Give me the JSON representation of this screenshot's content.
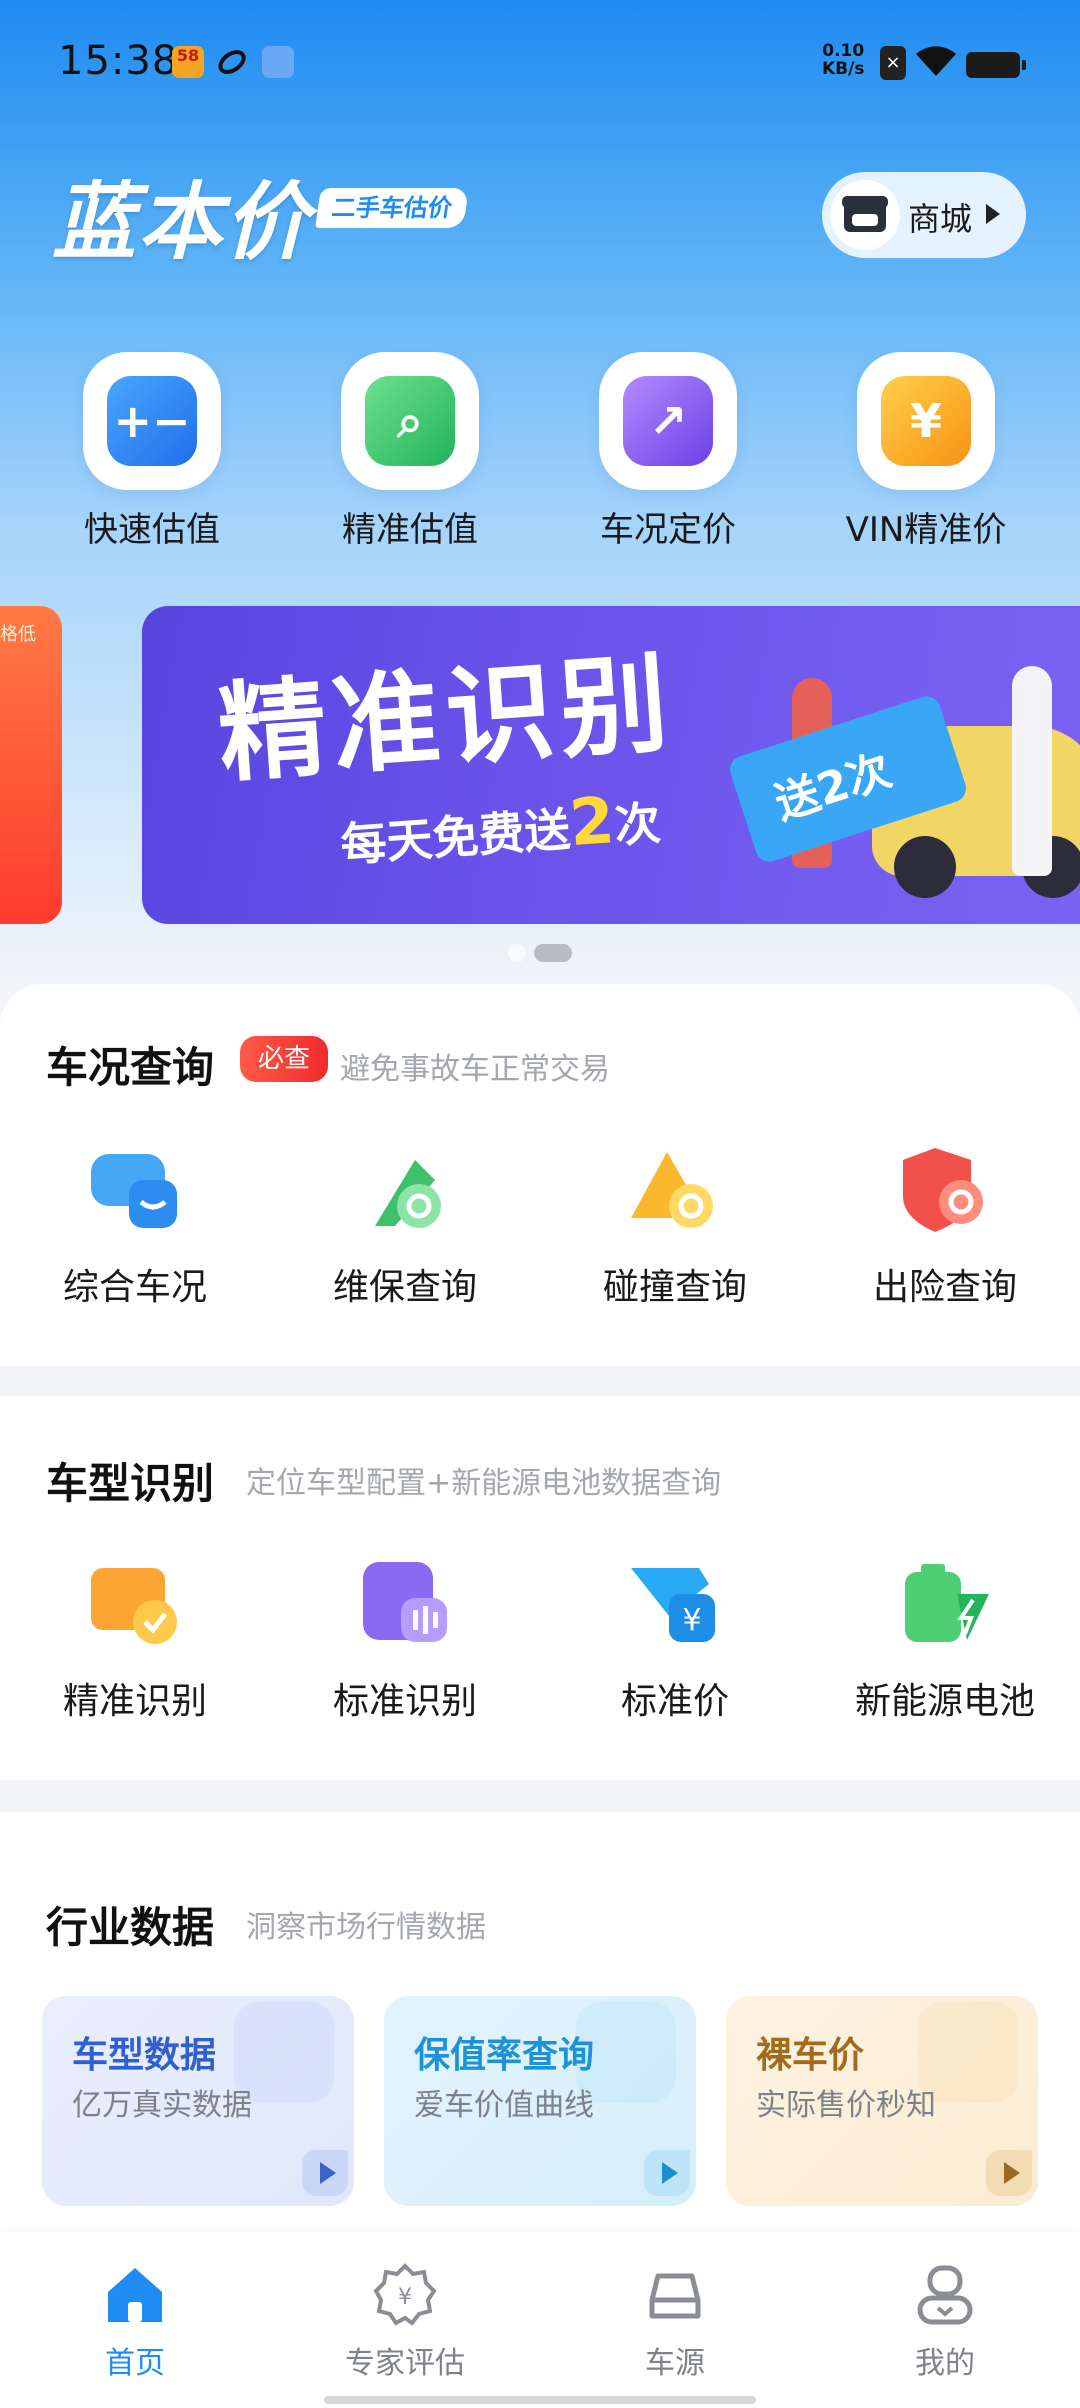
{
  "status_bar": {
    "time": "15:38",
    "app_badge": "58",
    "net_speed_value": "0.10",
    "net_speed_unit": "KB/s",
    "icons": [
      "58-app-icon",
      "swirl-app-icon",
      "ticket-app-icon",
      "sim-icon",
      "wifi-icon",
      "battery-icon"
    ]
  },
  "header": {
    "logo": "蓝本价",
    "logo_tag": "二手车估价",
    "shop_label": "商城"
  },
  "quick_tools": [
    {
      "label": "快速估值",
      "icon": "calculator-icon",
      "color": "#2b86f5"
    },
    {
      "label": "精准估值",
      "icon": "magnifier-icon",
      "color": "#37c46a"
    },
    {
      "label": "车况定价",
      "icon": "trend-icon",
      "color": "#8a5cf0"
    },
    {
      "label": "VIN精准价",
      "icon": "yen-icon",
      "color": "#f7a325"
    }
  ],
  "banner": {
    "prev_text": "格低",
    "title": "精准识别",
    "subtitle_prefix": "每天免费送",
    "subtitle_num": "2",
    "subtitle_suffix": "次",
    "ticket_text": "送2次",
    "active_index": 1,
    "count": 2
  },
  "condition": {
    "title": "车况查询",
    "badge": "必查",
    "subtitle": "避免事故车正常交易",
    "items": [
      {
        "label": "综合车况",
        "icon": "car-report-icon"
      },
      {
        "label": "维保查询",
        "icon": "wrench-search-icon"
      },
      {
        "label": "碰撞查询",
        "icon": "collision-warning-icon"
      },
      {
        "label": "出险查询",
        "icon": "insurance-shield-icon"
      }
    ]
  },
  "model": {
    "title": "车型识别",
    "subtitle": "定位车型配置+新能源电池数据查询",
    "items": [
      {
        "label": "精准识别",
        "icon": "folder-check-icon"
      },
      {
        "label": "标准识别",
        "icon": "voice-scan-icon"
      },
      {
        "label": "标准价",
        "icon": "price-tag-icon"
      },
      {
        "label": "新能源电池",
        "icon": "battery-charge-icon"
      }
    ]
  },
  "industry": {
    "title": "行业数据",
    "subtitle": "洞察市场行情数据",
    "cards": [
      {
        "title": "车型数据",
        "desc": "亿万真实数据",
        "accent": "#2f5fd0"
      },
      {
        "title": "保值率查询",
        "desc": "爱车价值曲线",
        "accent": "#1c93d8"
      },
      {
        "title": "裸车价",
        "desc": "实际售价秒知",
        "accent": "#a36a1c"
      }
    ]
  },
  "tabbar": {
    "tabs": [
      {
        "label": "首页",
        "icon": "home-icon",
        "active": true
      },
      {
        "label": "专家评估",
        "icon": "expert-badge-icon",
        "active": false
      },
      {
        "label": "车源",
        "icon": "car-icon",
        "active": false
      },
      {
        "label": "我的",
        "icon": "profile-icon",
        "active": false
      }
    ]
  },
  "colors": {
    "brand": "#1f8cf3",
    "must_badge": "#f23a33"
  }
}
